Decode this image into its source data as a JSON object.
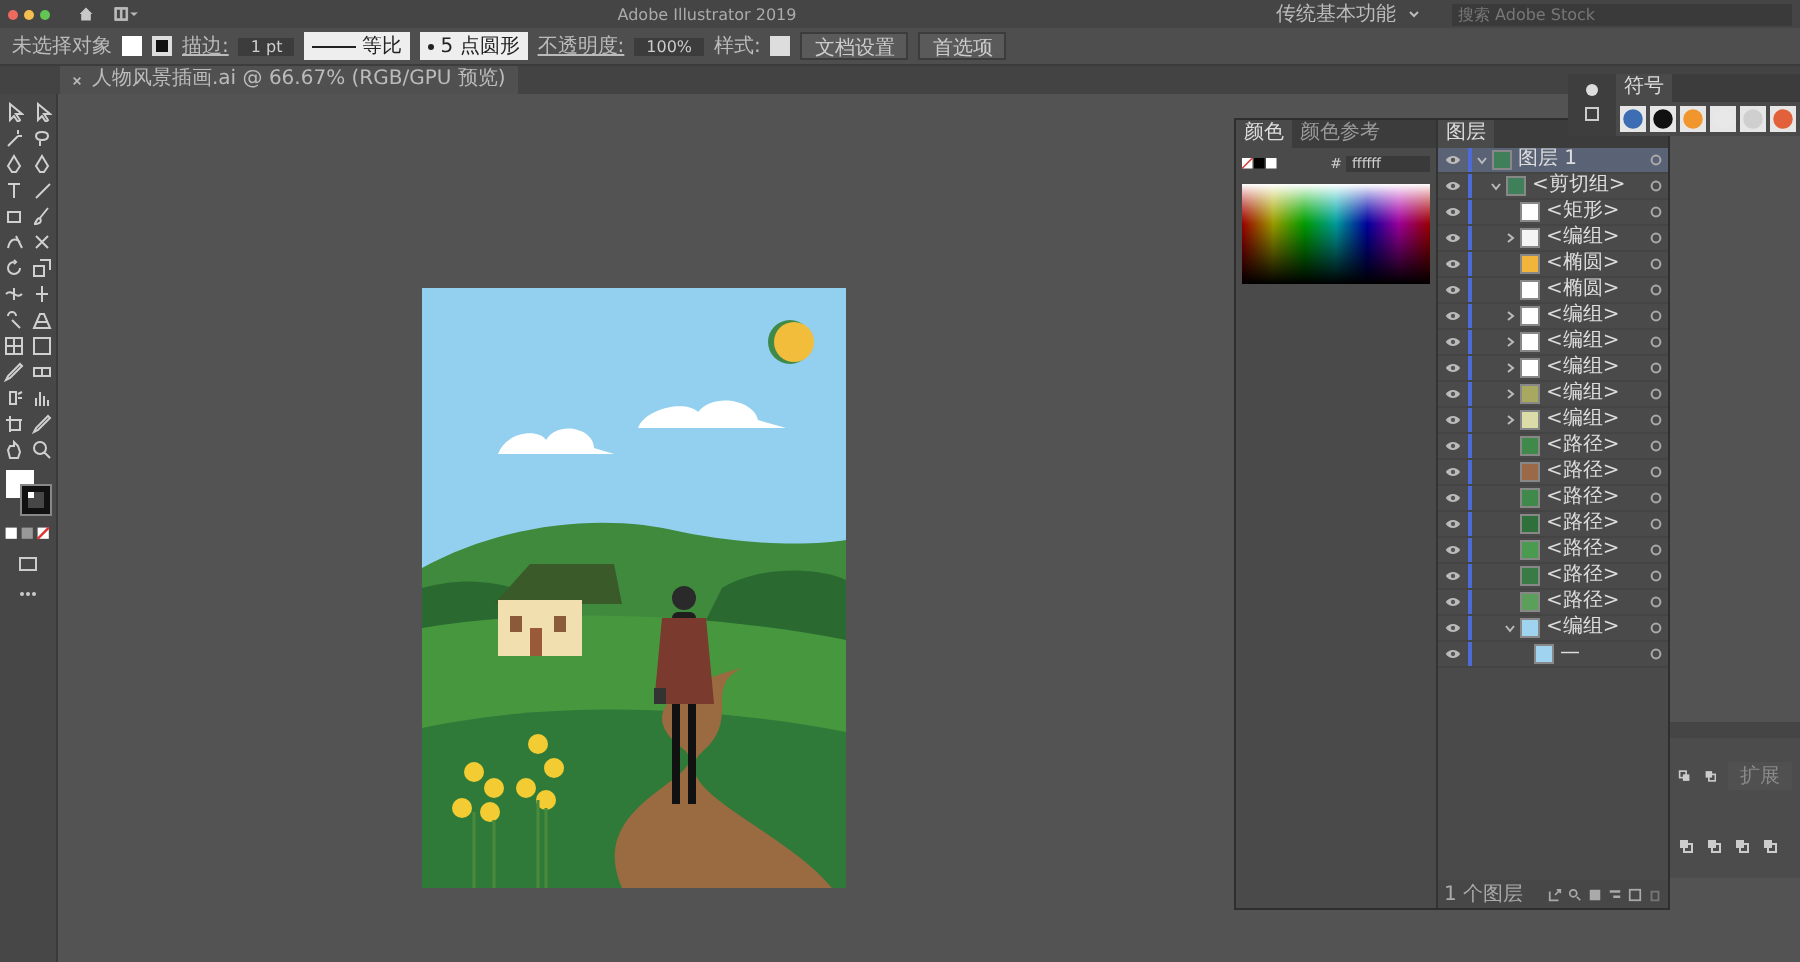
{
  "title_bar": {
    "title": "Adobe Illustrator 2019",
    "workspace": "传统基本功能",
    "search": {
      "placeholder": "搜索 Adobe Stock"
    }
  },
  "control_bar": {
    "selection": "未选择对象",
    "stroke_label": "描边:",
    "stroke_weight": "1 pt",
    "stroke_profile": "等比",
    "brush": "5 点圆形",
    "opacity_label": "不透明度:",
    "opacity": "100%",
    "style_label": "样式:",
    "buttons": [
      "文档设置",
      "首选项"
    ]
  },
  "document_tab": {
    "title": "人物风景插画.ai @ 66.67% (RGB/GPU 预览)"
  },
  "color_panel": {
    "tabs": [
      {
        "label": "颜色",
        "selected": true
      },
      {
        "label": "颜色参考",
        "selected": false
      }
    ],
    "hex_label": "#",
    "hex": "ffffff"
  },
  "layers_panel": {
    "tabs": [
      {
        "label": "图层",
        "selected": true
      }
    ],
    "footer": "1 个图层",
    "layers": [
      {
        "name": "图层 1",
        "expanded": true,
        "color": "#3f7f5a",
        "children": [
          {
            "name": "<剪切组>",
            "expanded": true,
            "color": "#3f7f5a",
            "children": [
              {
                "name": "<矩形>",
                "color": "#ffffff"
              },
              {
                "name": "<编组>",
                "expanded": false,
                "color": "#f4f4f4"
              },
              {
                "name": "<椭圆>",
                "color": "#f2b53c"
              },
              {
                "name": "<椭圆>",
                "color": "#ffffff"
              },
              {
                "name": "<编组>",
                "expanded": false,
                "color": "#ffffff"
              },
              {
                "name": "<编组>",
                "expanded": false,
                "color": "#ffffff"
              },
              {
                "name": "<编组>",
                "expanded": false,
                "color": "#ffffff"
              },
              {
                "name": "<编组>",
                "expanded": false,
                "color": "#a8a860"
              },
              {
                "name": "<编组>",
                "expanded": false,
                "color": "#dcdca8"
              },
              {
                "name": "<路径>",
                "color": "#3f8a4a"
              },
              {
                "name": "<路径>",
                "color": "#9a6a48"
              },
              {
                "name": "<路径>",
                "color": "#3f8a4a"
              },
              {
                "name": "<路径>",
                "color": "#2f6f3a"
              },
              {
                "name": "<路径>",
                "color": "#4a9a50"
              },
              {
                "name": "<路径>",
                "color": "#3a7a44"
              },
              {
                "name": "<路径>",
                "color": "#5aa05a"
              },
              {
                "name": "<编组>",
                "expanded": true,
                "color": "#9fd3ef",
                "children": [
                  {
                    "name": "—",
                    "color": "#9fd3ef"
                  }
                ]
              }
            ]
          }
        ]
      }
    ]
  },
  "symbols_panel": {
    "tabs": [
      {
        "label": "符号",
        "selected": true
      }
    ]
  },
  "pathfinder_panel": {
    "button": {
      "label": "扩展",
      "disabled": true
    }
  }
}
